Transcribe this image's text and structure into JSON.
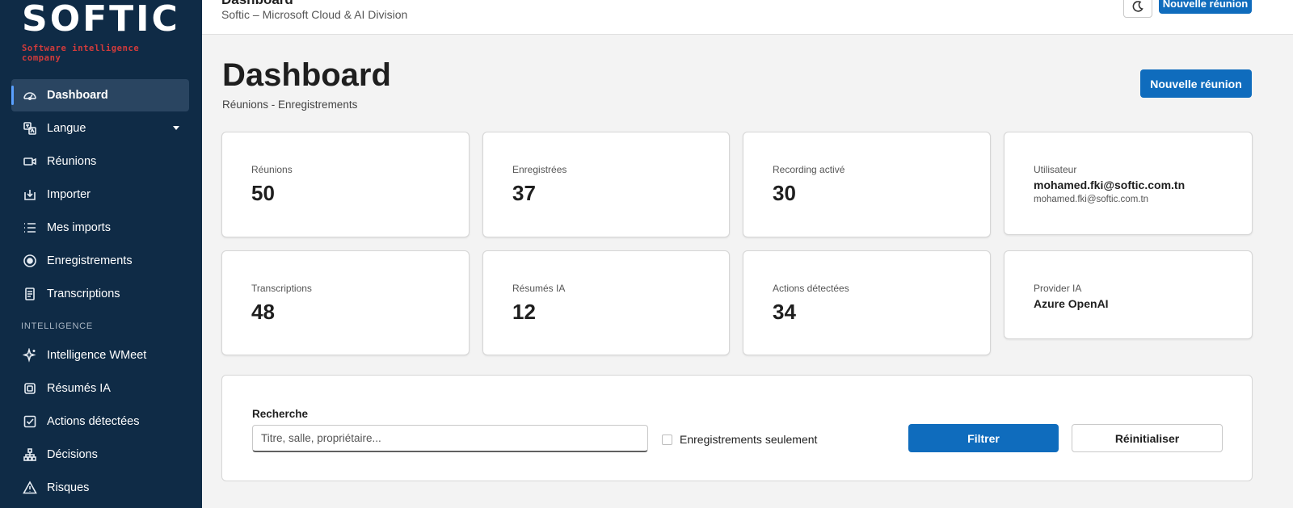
{
  "brand": {
    "name": "SOFTIC",
    "tagline": "Software intelligence company",
    "tagline_color": "#d33b3b"
  },
  "colors": {
    "sidebar_bg": "#0f2b46",
    "primary": "#0f6cbd",
    "active_indicator": "#5aa0ff"
  },
  "sidebar": {
    "items": [
      {
        "label": "Dashboard",
        "icon": "dashboard-gauge-icon",
        "active": true
      },
      {
        "label": "Langue",
        "icon": "translate-icon",
        "has_caret": true
      },
      {
        "label": "Réunions",
        "icon": "video-camera-icon"
      },
      {
        "label": "Importer",
        "icon": "import-tray-icon"
      },
      {
        "label": "Mes imports",
        "icon": "list-icon"
      },
      {
        "label": "Enregistrements",
        "icon": "record-icon"
      },
      {
        "label": "Transcriptions",
        "icon": "document-icon"
      }
    ],
    "section_title": "INTELLIGENCE",
    "section_items": [
      {
        "label": "Intelligence WMeet",
        "icon": "sparkle-icon"
      },
      {
        "label": "Résumés IA",
        "icon": "chip-icon"
      },
      {
        "label": "Actions détectées",
        "icon": "checkbox-icon"
      },
      {
        "label": "Décisions",
        "icon": "org-chart-icon"
      },
      {
        "label": "Risques",
        "icon": "warning-icon"
      }
    ]
  },
  "topbar": {
    "title": "Dashboard",
    "subtitle": "Softic – Microsoft Cloud & AI Division",
    "theme_icon": "moon-icon",
    "new_meeting_label": "Nouvelle réunion"
  },
  "header": {
    "title": "Dashboard",
    "subtitle": "Réunions - Enregistrements",
    "new_meeting_label": "Nouvelle réunion"
  },
  "stats": {
    "meetings": {
      "label": "Réunions",
      "value": "50"
    },
    "recorded": {
      "label": "Enregistrées",
      "value": "37"
    },
    "recording_active": {
      "label": "Recording activé",
      "value": "30"
    },
    "user": {
      "label": "Utilisateur",
      "name": "mohamed.fki@softic.com.tn",
      "email": "mohamed.fki@softic.com.tn"
    },
    "transcriptions": {
      "label": "Transcriptions",
      "value": "48"
    },
    "summaries": {
      "label": "Résumés IA",
      "value": "12"
    },
    "actions": {
      "label": "Actions détectées",
      "value": "34"
    },
    "provider": {
      "label": "Provider IA",
      "value": "Azure OpenAI"
    }
  },
  "filters": {
    "search_label": "Recherche",
    "search_value": "",
    "search_placeholder": "Titre, salle, propriétaire...",
    "recordings_only_label": "Enregistrements seulement",
    "recordings_only_checked": false,
    "filter_button": "Filtrer",
    "reset_button": "Réinitialiser"
  }
}
